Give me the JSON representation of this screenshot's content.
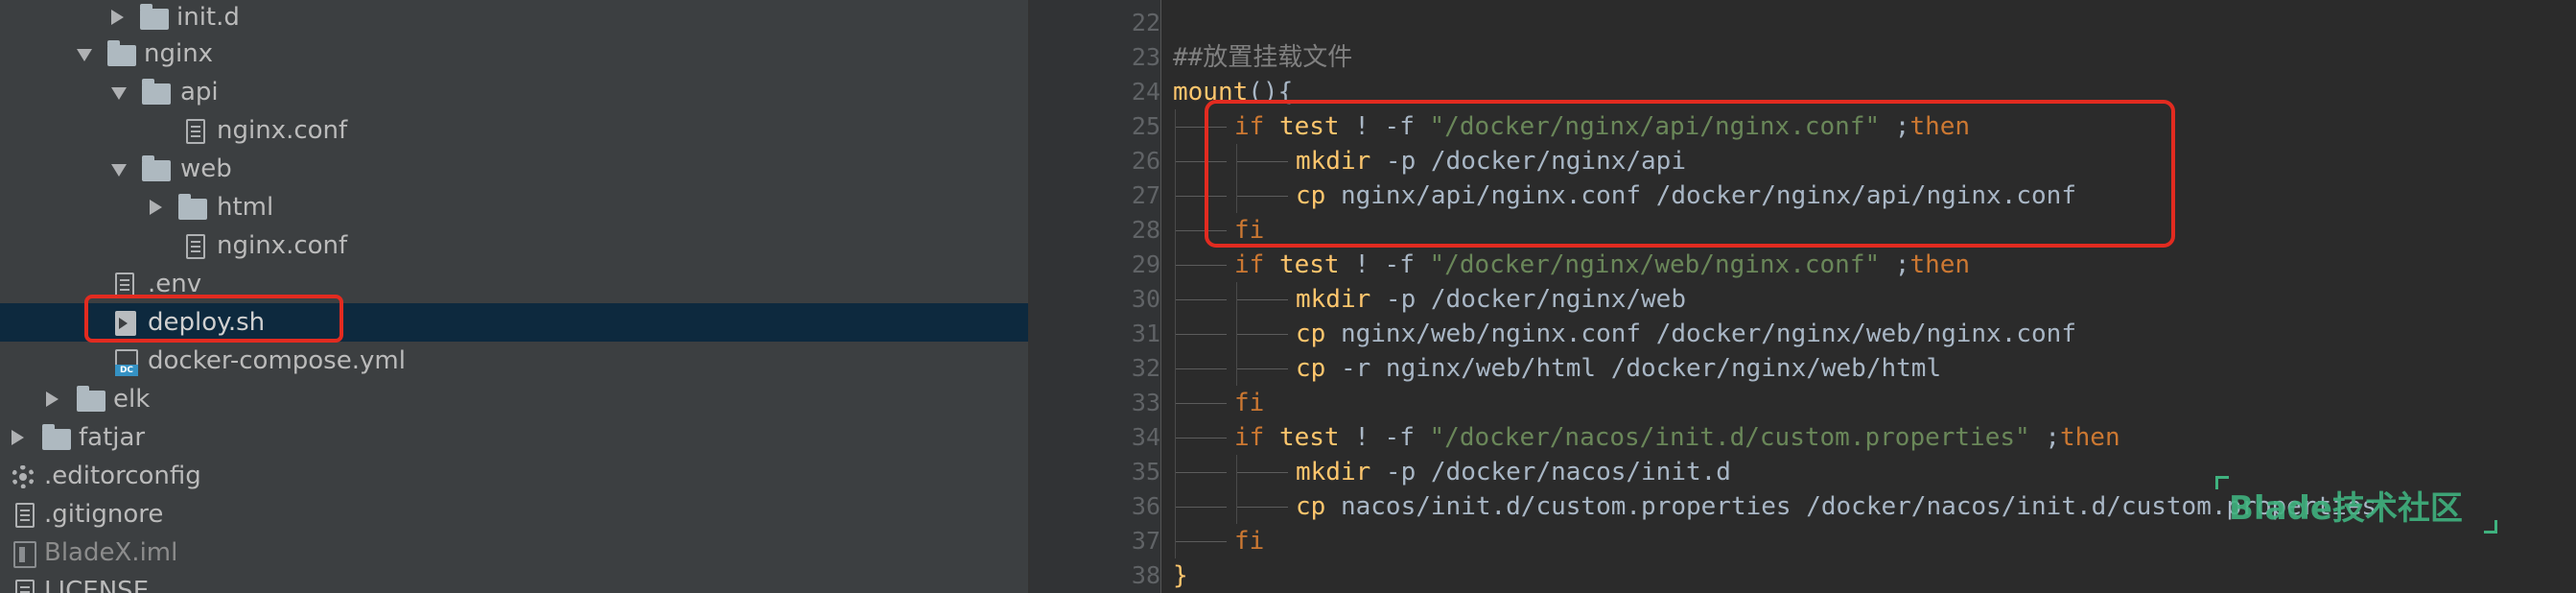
{
  "tree": {
    "items": [
      {
        "label": "init.d",
        "kind": "folder",
        "state": "collapsed"
      },
      {
        "label": "nginx",
        "kind": "folder",
        "state": "expanded"
      },
      {
        "label": "api",
        "kind": "folder",
        "state": "expanded"
      },
      {
        "label": "nginx.conf",
        "kind": "file"
      },
      {
        "label": "web",
        "kind": "folder",
        "state": "expanded"
      },
      {
        "label": "html",
        "kind": "folder",
        "state": "collapsed"
      },
      {
        "label": "nginx.conf",
        "kind": "file"
      },
      {
        "label": ".env",
        "kind": "file"
      },
      {
        "label": "deploy.sh",
        "kind": "shell-file",
        "selected": true
      },
      {
        "label": "docker-compose.yml",
        "kind": "docker-compose-file"
      },
      {
        "label": "elk",
        "kind": "folder",
        "state": "collapsed"
      },
      {
        "label": "fatjar",
        "kind": "folder",
        "state": "collapsed"
      },
      {
        "label": ".editorconfig",
        "kind": "config-file"
      },
      {
        "label": ".gitignore",
        "kind": "file"
      },
      {
        "label": "BladeX.iml",
        "kind": "module-file"
      },
      {
        "label": "LICENSE",
        "kind": "file"
      }
    ]
  },
  "editor": {
    "line_numbers": [
      "22",
      "23",
      "24",
      "25",
      "26",
      "27",
      "28",
      "29",
      "30",
      "31",
      "32",
      "33",
      "34",
      "35",
      "36",
      "37",
      "38"
    ],
    "lines": [
      [],
      [
        {
          "t": "##放置挂载文件",
          "c": "comment"
        }
      ],
      [
        {
          "t": "mount",
          "c": "cmd"
        },
        {
          "t": "(){",
          "c": "plain"
        }
      ],
      [
        {
          "t": "if ",
          "c": "kw"
        },
        {
          "t": "test ",
          "c": "cmd"
        },
        {
          "t": "! -f ",
          "c": "plain"
        },
        {
          "t": "\"/docker/nginx/api/nginx.conf\"",
          "c": "str"
        },
        {
          "t": " ;",
          "c": "plain"
        },
        {
          "t": "then",
          "c": "kw"
        }
      ],
      [
        {
          "t": "mkdir ",
          "c": "cmd"
        },
        {
          "t": "-p /docker/nginx/api",
          "c": "plain"
        }
      ],
      [
        {
          "t": "cp ",
          "c": "cmd"
        },
        {
          "t": "nginx/api/nginx.conf /docker/nginx/api/nginx.conf",
          "c": "plain"
        }
      ],
      [
        {
          "t": "fi",
          "c": "kw"
        }
      ],
      [
        {
          "t": "if ",
          "c": "kw"
        },
        {
          "t": "test ",
          "c": "cmd"
        },
        {
          "t": "! -f ",
          "c": "plain"
        },
        {
          "t": "\"/docker/nginx/web/nginx.conf\"",
          "c": "str"
        },
        {
          "t": " ;",
          "c": "plain"
        },
        {
          "t": "then",
          "c": "kw"
        }
      ],
      [
        {
          "t": "mkdir ",
          "c": "cmd"
        },
        {
          "t": "-p /docker/nginx/web",
          "c": "plain"
        }
      ],
      [
        {
          "t": "cp ",
          "c": "cmd"
        },
        {
          "t": "nginx/web/nginx.conf /docker/nginx/web/nginx.conf",
          "c": "plain"
        }
      ],
      [
        {
          "t": "cp ",
          "c": "cmd"
        },
        {
          "t": "-r nginx/web/html /docker/nginx/web/html",
          "c": "plain"
        }
      ],
      [
        {
          "t": "fi",
          "c": "kw"
        }
      ],
      [
        {
          "t": "if ",
          "c": "kw"
        },
        {
          "t": "test ",
          "c": "cmd"
        },
        {
          "t": "! -f ",
          "c": "plain"
        },
        {
          "t": "\"/docker/nacos/init.d/custom.properties\"",
          "c": "str"
        },
        {
          "t": " ;",
          "c": "plain"
        },
        {
          "t": "then",
          "c": "kw"
        }
      ],
      [
        {
          "t": "mkdir ",
          "c": "cmd"
        },
        {
          "t": "-p /docker/nacos/init.d",
          "c": "plain"
        }
      ],
      [
        {
          "t": "cp ",
          "c": "cmd"
        },
        {
          "t": "nacos/init.d/custom.properties /docker/nacos/init.d/custom.properties",
          "c": "plain"
        }
      ],
      [
        {
          "t": "fi",
          "c": "kw"
        }
      ],
      [
        {
          "t": "}",
          "c": "cmd"
        }
      ]
    ]
  },
  "watermark": {
    "text": "Blade技术社区"
  },
  "colors": {
    "tree_bg": "#3c3f41",
    "editor_bg": "#2b2b2b",
    "selection": "#0d293e",
    "highlight_box": "#e22b20",
    "keyword": "#cc7832",
    "command": "#ffc66d",
    "string": "#6a8759",
    "comment": "#808080"
  }
}
